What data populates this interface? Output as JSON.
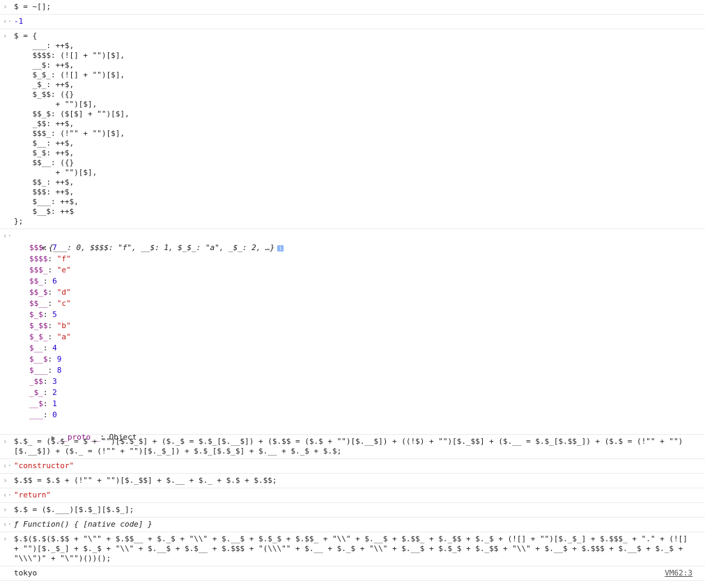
{
  "console": {
    "prompt_glyph": ">",
    "result_glyph": "<",
    "rows": {
      "r1_input": "$ = ~[];",
      "r1_output": "-1",
      "r2_input_lines": [
        "$ = {",
        "    ___: ++$,",
        "    $$$$: (![] + \"\")[$],",
        "    __$: ++$,",
        "    $_$_: (![] + \"\")[$],",
        "    _$_: ++$,",
        "    $_$$: ({}",
        "         + \"\")[$],",
        "    $$_$: ($[$] + \"\")[$],",
        "    _$$: ++$,",
        "    $$$_: (!\"\" + \"\")[$],",
        "    $__: ++$,",
        "    $_$: ++$,",
        "    $$__: ({}",
        "         + \"\")[$],",
        "    $$_: ++$,",
        "    $$$: ++$,",
        "    $___: ++$,",
        "    $__$: ++$",
        "};"
      ],
      "r2_summary": "{___: 0, $$$$: \"f\", __$: 1, $_$_: \"a\", _$_: 2, …}",
      "r2_props": [
        {
          "k": "$$$",
          "v": "7",
          "t": "num"
        },
        {
          "k": "$$$$",
          "v": "\"f\"",
          "t": "str"
        },
        {
          "k": "$$$_",
          "v": "\"e\"",
          "t": "str"
        },
        {
          "k": "$$_",
          "v": "6",
          "t": "num"
        },
        {
          "k": "$$_$",
          "v": "\"d\"",
          "t": "str"
        },
        {
          "k": "$$__",
          "v": "\"c\"",
          "t": "str"
        },
        {
          "k": "$_$",
          "v": "5",
          "t": "num"
        },
        {
          "k": "$_$$",
          "v": "\"b\"",
          "t": "str"
        },
        {
          "k": "$_$_",
          "v": "\"a\"",
          "t": "str"
        },
        {
          "k": "$__",
          "v": "4",
          "t": "num"
        },
        {
          "k": "$__$",
          "v": "9",
          "t": "num"
        },
        {
          "k": "$___",
          "v": "8",
          "t": "num"
        },
        {
          "k": "_$$",
          "v": "3",
          "t": "num"
        },
        {
          "k": "_$_",
          "v": "2",
          "t": "num"
        },
        {
          "k": "__$",
          "v": "1",
          "t": "num"
        },
        {
          "k": "___",
          "v": "0",
          "t": "num"
        }
      ],
      "r2_proto_key": "__proto__",
      "r2_proto_val": "Object",
      "r3_input": "$.$_ = ($.$_ = $ + \"\")[$.$_$] + ($._$ = $.$_[$.__$]) + ($.$$ = ($.$ + \"\")[$.__$]) + ((!$) + \"\")[$._$$] + ($.__ = $.$_[$.$$_]) + ($.$ = (!\"\" + \"\")[$.__$]) + ($._ = (!\"\" + \"\")[$._$_]) + $.$_[$.$_$] + $.__ + $._$ + $.$;",
      "r3_output": "\"constructor\"",
      "r4_input": "$.$$ = $.$ + (!\"\" + \"\")[$._$$] + $.__ + $._ + $.$ + $.$$;",
      "r4_output": "\"return\"",
      "r5_input": "$.$ = ($.___)[$.$_][$.$_];",
      "r5_output": "ƒ Function() { [native code] }",
      "r6_input": "$.$($.$($.$$ + \"\\\"\" + $.$$__ + $._$ + \"\\\\\" + $.__$ + $.$_$ + $.$$_ + \"\\\\\" + $.__$ + $.$$_ + $._$$ + $._$ + (![] + \"\")[$._$_] + $.$$$_ + \".\" + (![] + \"\")[$._$_] + $._$ + \"\\\\\" + $.__$ + $.$__ + $.$$$ + \"(\\\\\\\"\" + $.__ + $._$ + \"\\\\\" + $.__$ + $.$_$ + $._$$ + \"\\\\\" + $.__$ + $.$$$ + $.__$ + $._$ + \"\\\\\\\")\" + \"\\\"\")())();",
      "r6_output": "tokyo",
      "r6_source": "VM62:3"
    }
  }
}
